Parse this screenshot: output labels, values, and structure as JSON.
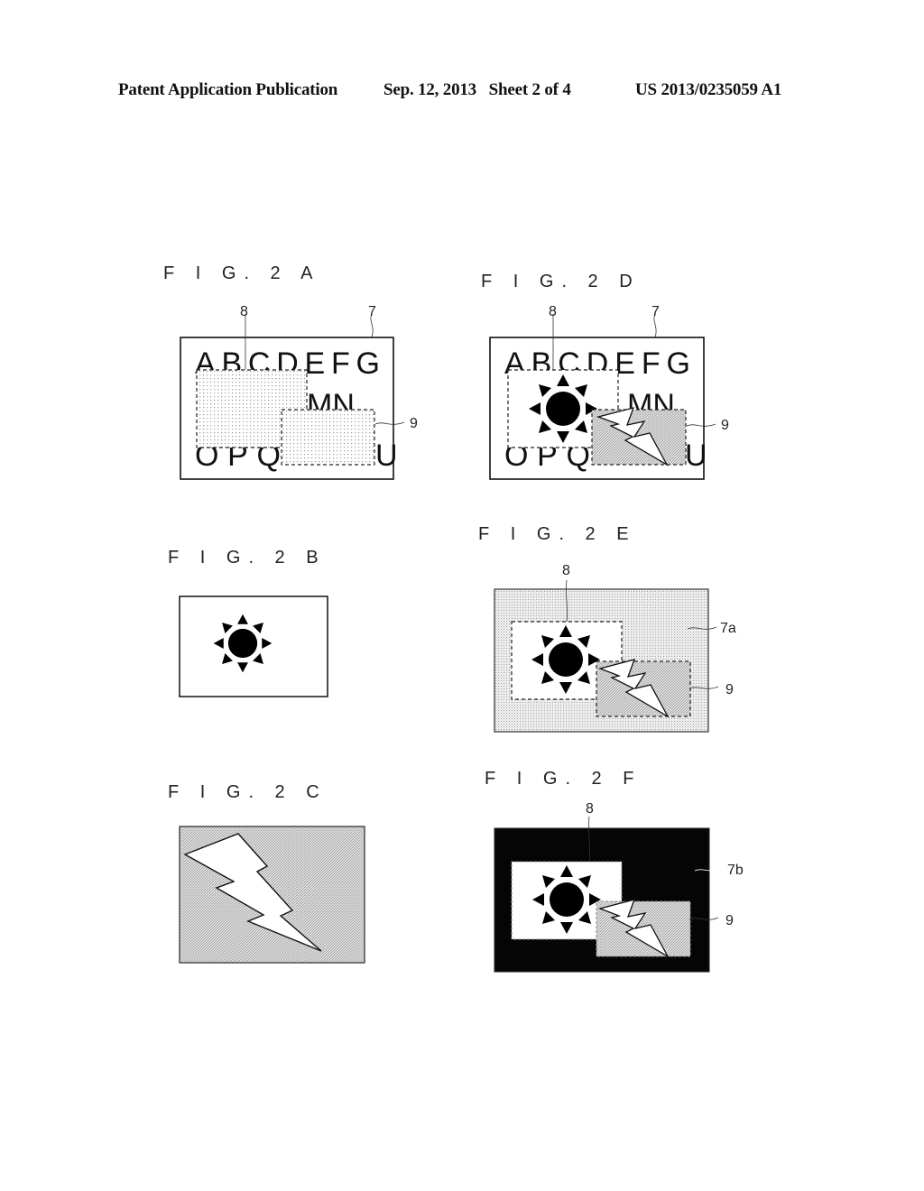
{
  "header": {
    "publication": "Patent Application Publication",
    "date_sheet": "Sep. 12, 2013   Sheet 2 of 4",
    "patent_number": "US 2013/0235059 A1"
  },
  "figures": {
    "fig2a": {
      "label": "F I G. 2 A",
      "refs": {
        "image": "7",
        "region1": "8",
        "region2": "9"
      },
      "text_row1": "ABCDEFG",
      "text_row2": "MN",
      "text_row3_left": "OPQ",
      "text_row3_right": "U"
    },
    "fig2b": {
      "label": "F I G. 2 B",
      "content": "sun-icon"
    },
    "fig2c": {
      "label": "F I G. 2 C",
      "content": "lightning-icon"
    },
    "fig2d": {
      "label": "F I G. 2 D",
      "refs": {
        "image": "7",
        "region1": "8",
        "region2": "9"
      },
      "text_row1": "ABCDEFG",
      "text_row2": "MN",
      "text_row3_left": "OPQ",
      "text_row3_right": "U"
    },
    "fig2e": {
      "label": "F I G. 2 E",
      "refs": {
        "image": "7a",
        "region1": "8",
        "region2": "9"
      }
    },
    "fig2f": {
      "label": "F I G. 2 F",
      "refs": {
        "image": "7b",
        "region1": "8",
        "region2": "9"
      }
    }
  },
  "colors": {
    "ink": "#111111",
    "paper": "#ffffff",
    "shade": "#d4d4d4",
    "dark_bg": "#050505"
  }
}
